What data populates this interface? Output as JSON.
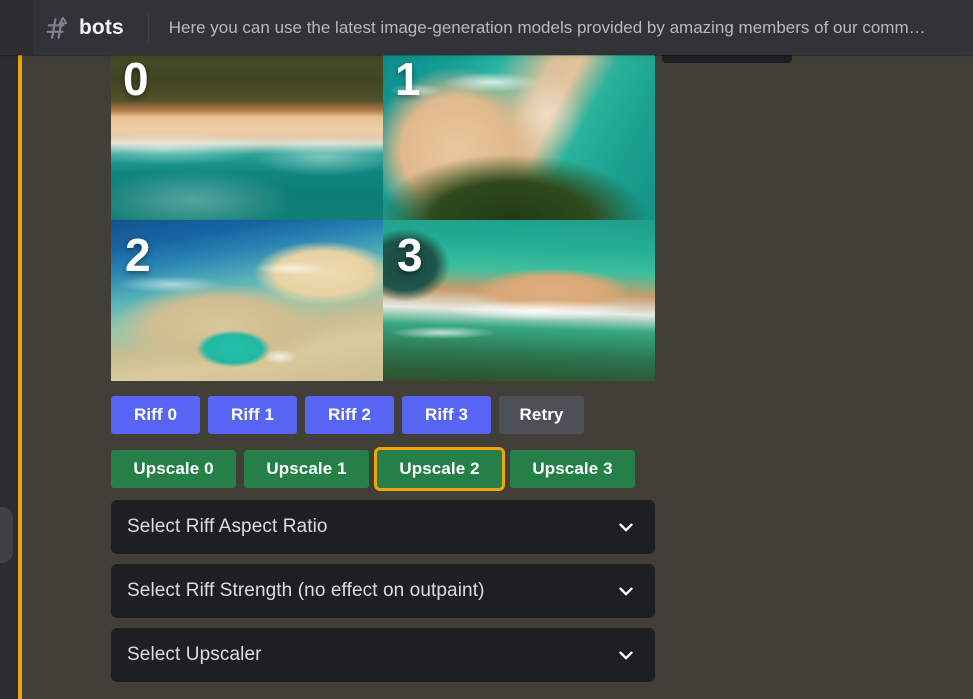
{
  "header": {
    "channel_icon": "hashtag-age-restricted-icon",
    "channel_name": "bots",
    "topic": "Here you can use the latest image-generation models provided by amazing members of our comm…"
  },
  "accent_colors": {
    "selection_orange": "#f0a30a",
    "riff_blurple": "#5865f2",
    "upscale_green": "#248046",
    "retry_grey": "#4e5058",
    "message_background": "#423f38",
    "header_background": "#313338",
    "select_background": "#1e1f22"
  },
  "image_grid": {
    "tiles": [
      {
        "index": "0",
        "selected": false,
        "alt": "aerial beach, forest strip above pale sand and turquoise surf"
      },
      {
        "index": "1",
        "selected": false,
        "alt": "aerial headland, turquoise water with sand spit and green bush"
      },
      {
        "index": "2",
        "selected": true,
        "alt": "aerial reef lagoon, deep blue water, sand bar and green pool"
      },
      {
        "index": "3",
        "selected": false,
        "alt": "aerial shoreline, white breaking wave across orange sand"
      }
    ]
  },
  "riff_buttons": [
    {
      "label": "Riff 0",
      "style": "primary",
      "selected": false
    },
    {
      "label": "Riff 1",
      "style": "primary",
      "selected": false
    },
    {
      "label": "Riff 2",
      "style": "primary",
      "selected": false
    },
    {
      "label": "Riff 3",
      "style": "primary",
      "selected": false
    },
    {
      "label": "Retry",
      "style": "secondary",
      "selected": false
    }
  ],
  "upscale_buttons": [
    {
      "label": "Upscale 0",
      "style": "success",
      "selected": false
    },
    {
      "label": "Upscale 1",
      "style": "success",
      "selected": false
    },
    {
      "label": "Upscale 2",
      "style": "success",
      "selected": true
    },
    {
      "label": "Upscale 3",
      "style": "success",
      "selected": false
    }
  ],
  "selects": [
    {
      "label": "Select Riff Aspect Ratio",
      "icon": "chevron-down-icon"
    },
    {
      "label": "Select Riff Strength (no effect on outpaint)",
      "icon": "chevron-down-icon"
    },
    {
      "label": "Select Upscaler",
      "icon": "chevron-down-icon"
    }
  ]
}
